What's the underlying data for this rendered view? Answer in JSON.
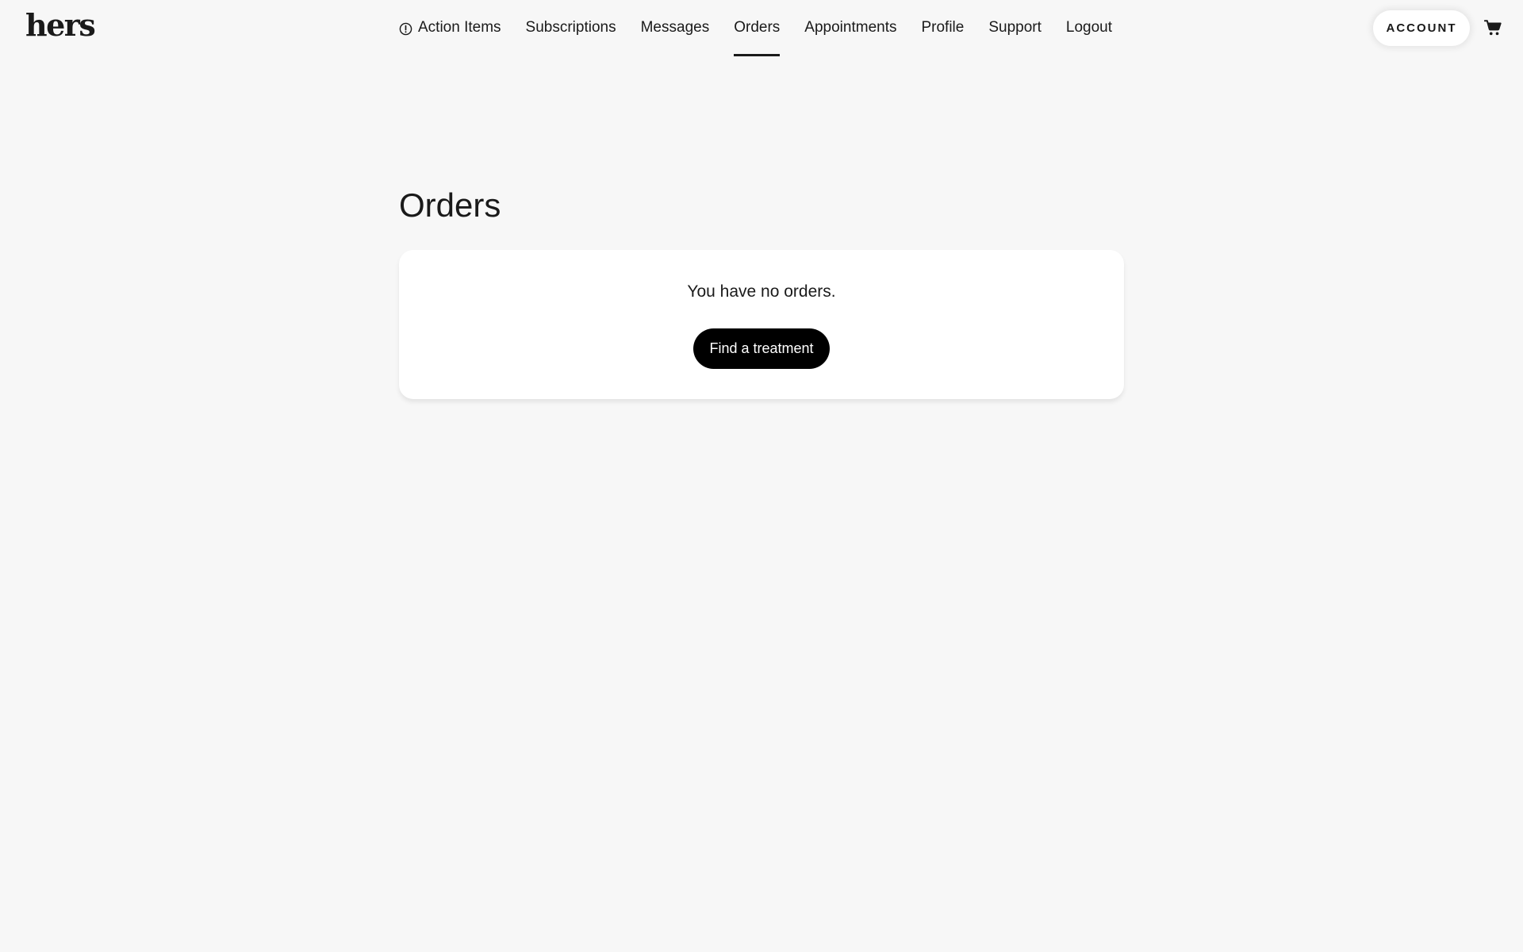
{
  "brand": {
    "logo_text": "hers"
  },
  "nav": {
    "items": [
      {
        "label": "Action Items",
        "icon": "alert-circle-icon"
      },
      {
        "label": "Subscriptions"
      },
      {
        "label": "Messages"
      },
      {
        "label": "Orders",
        "active": true
      },
      {
        "label": "Appointments"
      },
      {
        "label": "Profile"
      },
      {
        "label": "Support"
      },
      {
        "label": "Logout"
      }
    ]
  },
  "header": {
    "account_label": "ACCOUNT",
    "cart_icon": "shopping-cart-icon"
  },
  "main": {
    "title": "Orders",
    "empty_message": "You have no orders.",
    "cta_label": "Find a treatment"
  },
  "colors": {
    "background": "#f7f7f7",
    "card": "#ffffff",
    "primary_button": "#000000",
    "text": "#1a1a1a"
  }
}
